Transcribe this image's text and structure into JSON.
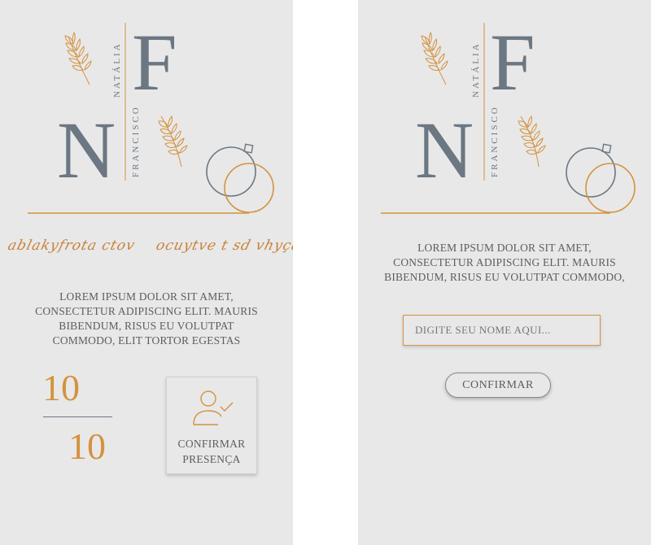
{
  "colors": {
    "background": "#e8e8e8",
    "accent": "#d4923f",
    "slate": "#6b7782",
    "text": "#5d5d5d"
  },
  "monogram": {
    "letter_top": "F",
    "letter_bottom": "N",
    "name_top": "NATÁLIA",
    "name_bottom": "FRANCISCO",
    "icons": [
      "wheat-sprig-icon",
      "wedding-rings-icon"
    ]
  },
  "screen_left": {
    "script_text": [
      "ablakyfrota ctov",
      "ocuytve t sd vhyçar"
    ],
    "body_text": "Lorem ipsum dolor sit amet, consectetur adipiscing elit. Mauris bibendum, risus eu volutpat commodo, elit tortor egestas",
    "date": {
      "day": "10",
      "month": "10"
    },
    "rsvp": {
      "icon": "user-check-icon",
      "label_line1": "CONFIRMAR",
      "label_line2": "PRESENÇA"
    }
  },
  "screen_right": {
    "body_text": "Lorem ipsum dolor sit amet, consectetur adipiscing elit. Mauris bibendum, risus eu volutpat commodo,",
    "name_input": {
      "placeholder": "DIGITE SEU NOME AQUI...",
      "value": ""
    },
    "confirm_label": "CONFIRMAR"
  }
}
